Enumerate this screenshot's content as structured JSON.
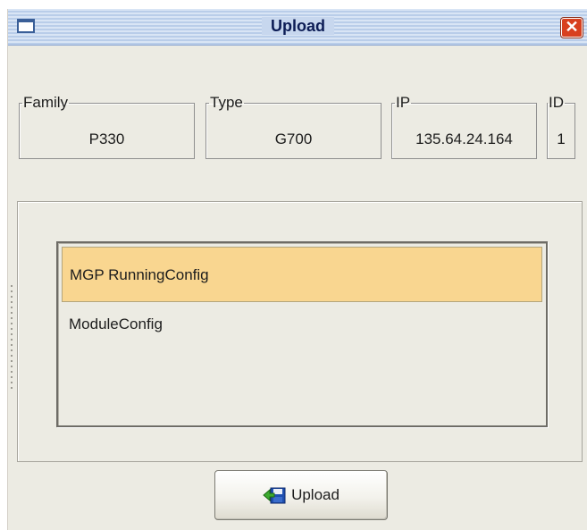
{
  "window": {
    "title": "Upload"
  },
  "fields": [
    {
      "legend": "Family",
      "value": "P330"
    },
    {
      "legend": "Type",
      "value": "G700"
    },
    {
      "legend": "IP",
      "value": "135.64.24.164"
    },
    {
      "legend": "ID",
      "value": "1"
    }
  ],
  "list": {
    "items": [
      {
        "label": "MGP RunningConfig",
        "selected": true
      },
      {
        "label": "ModuleConfig",
        "selected": false
      }
    ]
  },
  "actions": {
    "upload_label": "Upload"
  },
  "icons": {
    "window": "window-icon",
    "close": "close-icon",
    "upload": "upload-icon"
  },
  "colors": {
    "selection": "#f9d690",
    "close_button": "#d8401f",
    "background": "#ecebe3"
  }
}
